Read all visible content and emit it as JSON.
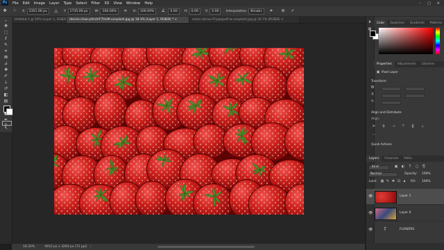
{
  "app": {
    "logo": "Ps"
  },
  "menu": [
    "File",
    "Edit",
    "Image",
    "Layer",
    "Type",
    "Select",
    "Filter",
    "3D",
    "View",
    "Window",
    "Help"
  ],
  "window_controls": [
    "–",
    "▢",
    "✕"
  ],
  "options": {
    "x_label": "X:",
    "x_value": "2351.00 px",
    "y_label": "Y:",
    "y_value": "1735.00 px",
    "w_label": "W:",
    "w_value": "100.00%",
    "h_label": "H:",
    "h_value": "100.00%",
    "angle_value": "0.00",
    "h2_label": "H:",
    "h2_value": "0.00",
    "v_label": "V:",
    "v_value": "0.00",
    "interp_label": "Interpolation:",
    "interp_value": "Bicubic",
    "cancel": "⊘",
    "commit": "✓"
  },
  "tabs": [
    {
      "label": "Untitled-1 @ 50% (Layer 1, RGB/8) *  ×",
      "active": false
    },
    {
      "label": "dennis-chao-pXmhrF7HnM-unsplash.jpg @ 18.3% (Layer 1, RGB/8) *  ×",
      "active": true
    },
    {
      "label": "anton-darius-FCjqeypeP-w-unsplash.jpg @ 16.7% (RGB/8)  ×",
      "active": false
    }
  ],
  "status": {
    "zoom": "18.32%",
    "doc_size": "4912 px x 3264 px (72 ppi)"
  },
  "color_panel": {
    "tabs": [
      "Color",
      "Swatches",
      "Gradients",
      "Patterns"
    ]
  },
  "properties_panel": {
    "tabs": [
      "Properties",
      "Adjustments",
      "Libraries"
    ],
    "layer_type": "Pixel Layer",
    "transform_label": "Transform",
    "align_label": "Align and Distribute",
    "align_sub": "Align:",
    "quick_actions": "Quick Actions"
  },
  "layers_panel": {
    "tabs": [
      "Layers",
      "Channels",
      "Paths"
    ],
    "filter_label": "Kind",
    "blend_mode": "Normal",
    "opacity_label": "Opacity:",
    "opacity_value": "100%",
    "lock_label": "Lock:",
    "fill_label": "Fill:",
    "fill_value": "100%",
    "layers": [
      {
        "name": "Layer 1",
        "selected": true
      },
      {
        "name": "Layer 0",
        "selected": false
      },
      {
        "name": "FLOWERS",
        "selected": false
      }
    ]
  },
  "colors": {
    "accent": "#31a8ff",
    "strawberry": "#b3141a",
    "leaf": "#4e8f2a"
  }
}
